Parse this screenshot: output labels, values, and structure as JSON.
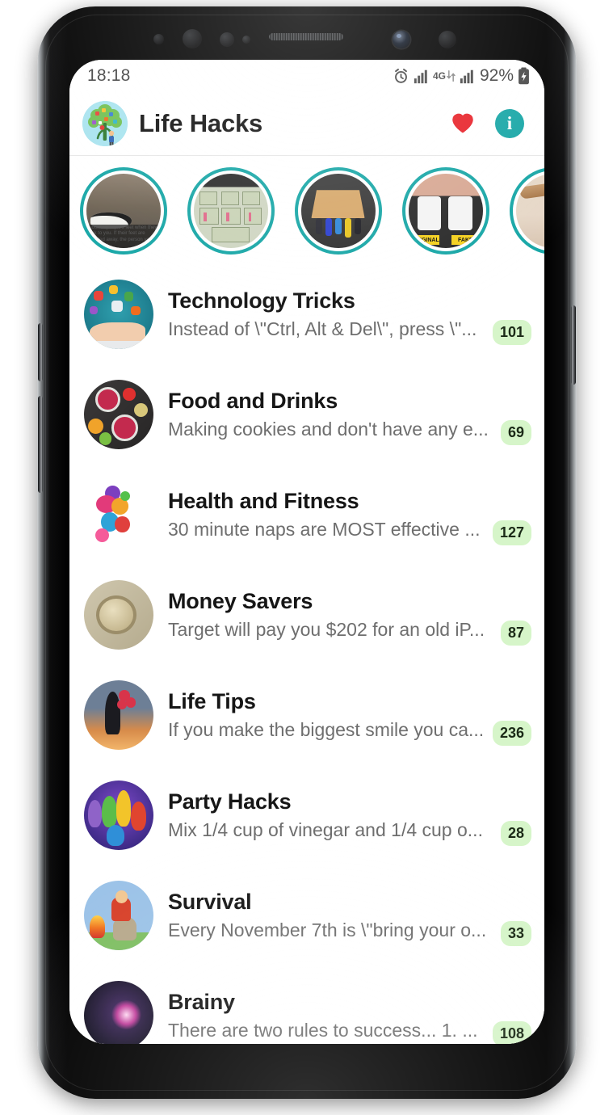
{
  "status_bar": {
    "time": "18:18",
    "battery_text": "92%",
    "network_label": "4G",
    "icons": [
      "alarm-icon",
      "signal-icon",
      "network-4g-icon",
      "signal-icon",
      "battery-charging-icon"
    ]
  },
  "app_bar": {
    "title": "Life Hacks",
    "logo_name": "app-logo-tree",
    "favorite_icon": "heart-icon",
    "info_icon": "info-icon",
    "heart_color": "#e8232a",
    "info_color": "#18a7a7"
  },
  "theme": {
    "accent": "#18a7a7",
    "badge_bg": "#d6f5c9",
    "title_color": "#161616",
    "subtitle_color": "#6e6e6e"
  },
  "stories": [
    {
      "id": "story-1",
      "art": "art-shoes",
      "caption": "Look at people's feet when they talk to you. If their feet are pointed away, the person you're talking to..."
    },
    {
      "id": "story-2",
      "art": "art-money",
      "caption": ""
    },
    {
      "id": "story-3",
      "art": "art-keys",
      "caption": ""
    },
    {
      "id": "story-4",
      "art": "art-chargers",
      "caption": "",
      "label_left": "ORIGINAL",
      "label_right": "FAKE"
    },
    {
      "id": "story-5",
      "art": "art-plant",
      "caption": ""
    }
  ],
  "list": [
    {
      "title": "Technology Tricks",
      "subtitle": "Instead of \\\"Ctrl, Alt & Del\\\", press \\\"...",
      "count": "101",
      "avatar": "av-tech"
    },
    {
      "title": "Food and Drinks",
      "subtitle": "Making cookies and don't have any e...",
      "count": "69",
      "avatar": "av-food"
    },
    {
      "title": "Health and Fitness",
      "subtitle": "30 minute naps are MOST effective ...",
      "count": "127",
      "avatar": "av-health"
    },
    {
      "title": "Money Savers",
      "subtitle": "Target will pay you $202 for an old iP...",
      "count": "87",
      "avatar": "av-money"
    },
    {
      "title": "Life Tips",
      "subtitle": "If you make the biggest smile you ca...",
      "count": "236",
      "avatar": "av-life"
    },
    {
      "title": "Party Hacks",
      "subtitle": "Mix 1/4 cup of vinegar and 1/4 cup o...",
      "count": "28",
      "avatar": "av-party"
    },
    {
      "title": "Survival",
      "subtitle": "Every November 7th is \\\"bring your o...",
      "count": "33",
      "avatar": "av-surv"
    },
    {
      "title": "Brainy",
      "subtitle": "There are two rules to success... 1. ...",
      "count": "108",
      "avatar": "av-brain"
    }
  ]
}
